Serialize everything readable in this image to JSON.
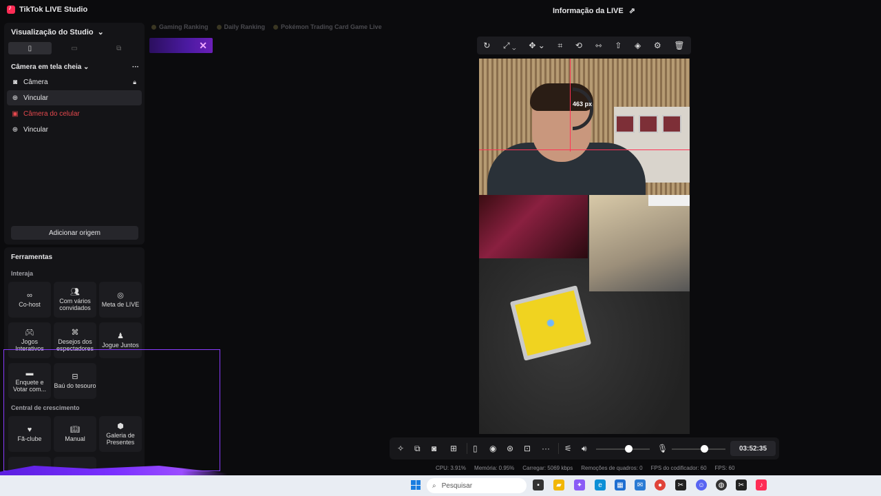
{
  "app": {
    "title": "TikTok LIVE Studio",
    "live_info": "Informação da LIVE"
  },
  "studio": {
    "view_label": "Visualização do Studio",
    "scene_label": "Câmera em tela cheia",
    "sources": [
      {
        "label": "Câmera",
        "icon": "camera-icon",
        "locked": true
      },
      {
        "label": "Vincular",
        "icon": "globe-icon"
      },
      {
        "label": "Câmera do celular",
        "icon": "phone-camera-icon",
        "state": "error"
      },
      {
        "label": "Vincular",
        "icon": "globe-icon"
      }
    ],
    "add_source": "Adicionar origem"
  },
  "tools": {
    "title": "Ferramentas",
    "interact_label": "Interaja",
    "interact": [
      "Co-host",
      "Com vários convidados",
      "Meta de LIVE",
      "Jogos Interativos",
      "Desejos dos espectadores",
      "Jogue Juntos",
      "Enquete e Votar com...",
      "Baú do tesouro"
    ],
    "growth_label": "Central de crescimento",
    "growth": [
      "Fã-clube",
      "Manual",
      "Galeria de Presentes"
    ]
  },
  "rankings": [
    "Gaming Ranking",
    "Daily Ranking",
    "Pokémon Trading Card Game Live"
  ],
  "preview": {
    "guide_label": "463 px"
  },
  "controls": {
    "timer": "03:52:35",
    "volume_level": 0.6,
    "mic_level": 0.6
  },
  "stats": {
    "cpu": "CPU: 3.91%",
    "memory": "Memória: 0.95%",
    "upload": "Carregar: 5069 kbps",
    "dropped": "Remoções de quadros: 0",
    "encoder_fps": "FPS do codificador: 60",
    "fps": "FPS: 60"
  },
  "taskbar": {
    "search_placeholder": "Pesquisar"
  },
  "colors": {
    "accent": "#fe2c55",
    "error": "#e5484d",
    "selection": "#8a3cff"
  }
}
